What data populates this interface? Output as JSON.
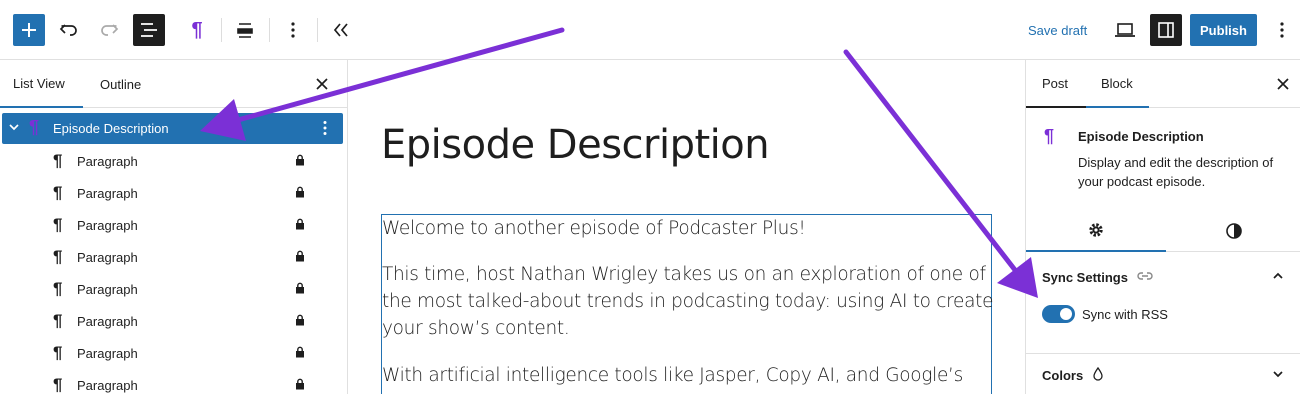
{
  "toolbar": {
    "save_draft_label": "Save draft",
    "publish_label": "Publish",
    "block_type_glyph": "¶"
  },
  "left_panel": {
    "tabs": [
      {
        "label": "List View"
      },
      {
        "label": "Outline"
      }
    ],
    "selected_item": {
      "label": "Episode Description"
    },
    "items": [
      {
        "label": "Paragraph"
      },
      {
        "label": "Paragraph"
      },
      {
        "label": "Paragraph"
      },
      {
        "label": "Paragraph"
      },
      {
        "label": "Paragraph"
      },
      {
        "label": "Paragraph"
      },
      {
        "label": "Paragraph"
      },
      {
        "label": "Paragraph"
      }
    ]
  },
  "canvas": {
    "title": "Episode Description",
    "paragraphs": [
      "Welcome to another episode of Podcaster Plus!",
      "This time, host Nathan Wrigley takes us on an exploration of one of the most talked-about trends in podcasting today: using AI to create your show’s content.",
      "With artificial intelligence tools like Jasper, Copy AI, and Google’s"
    ]
  },
  "right_panel": {
    "tabs": [
      {
        "label": "Post"
      },
      {
        "label": "Block"
      }
    ],
    "block_card": {
      "title": "Episode Description",
      "description": "Display and edit the description of your podcast episode."
    },
    "sync_settings": {
      "title": "Sync Settings",
      "toggle_label": "Sync with RSS",
      "toggle_on": true
    },
    "colors": {
      "title": "Colors"
    }
  },
  "colors": {
    "accent": "#2271b1",
    "block_icon": "#7b30d6",
    "annotation_arrow": "#7b30d6"
  }
}
